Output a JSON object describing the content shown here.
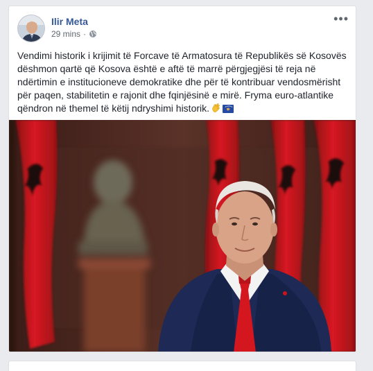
{
  "post": {
    "author": "Ilir Meta",
    "time": "29 mins",
    "separator": "·",
    "privacy_icon": "globe-icon",
    "options_icon": "more-options-icon",
    "text": "Vendimi historik i krijimit të Forcave të Armatosura të Republikës së Kosovës dëshmon qartë që Kosova është e aftë të marrë përgjegjësi të reja në ndërtimin e institucioneve demokratike dhe për të kontribuar vendosmërisht për paqen, stabilitetin e rajonit dhe fqinjësinë e mirë. Fryma euro-atlantike qëndron në themel të këtij ndryshimi historik.",
    "emojis": [
      "clapping-hands-emoji",
      "kosovo-flag-emoji"
    ],
    "photo": "man-in-suit-red-tie-with-albanian-flags-and-bust"
  },
  "colors": {
    "author_link": "#365899",
    "meta_text": "#616770",
    "body_text": "#1d2129",
    "feed_bg": "#e9ebee",
    "flag_red": "#c8141c"
  }
}
